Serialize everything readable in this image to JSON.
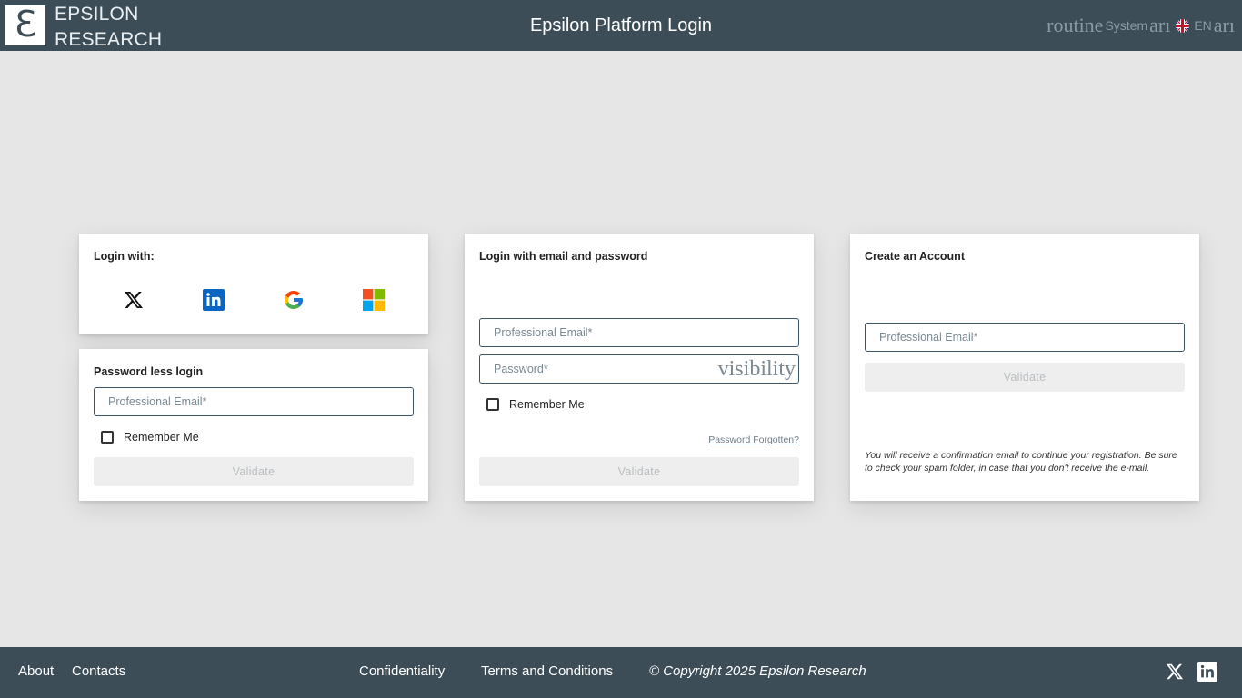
{
  "header": {
    "logo_glyph": "ℇ",
    "logo_line1": "EPSILON",
    "logo_line2": "RESEARCH",
    "title": "Epsilon Platform Login",
    "theme_icon": "routine",
    "theme_label": "System",
    "theme_dropdown_icon": "arı",
    "language": "EN",
    "language_dropdown_icon": "arı",
    "language_flag_icon": "uk-flag-icon"
  },
  "social_card": {
    "title": "Login with:",
    "providers": [
      "x-icon",
      "linkedin-icon",
      "google-icon",
      "microsoft-icon"
    ]
  },
  "passwordless_card": {
    "title": "Password less login",
    "email_placeholder": "Professional Email*",
    "remember_label": "Remember Me",
    "validate_label": "Validate"
  },
  "email_password_card": {
    "title": "Login with email and password",
    "email_placeholder": "Professional Email*",
    "password_placeholder": "Password*",
    "visibility_icon": "visibility",
    "remember_label": "Remember Me",
    "forgot_label": "Password Forgotten?",
    "validate_label": "Validate"
  },
  "create_account_card": {
    "title": "Create an Account",
    "email_placeholder": "Professional Email*",
    "validate_label": "Validate",
    "note": "You will receive a confirmation email to continue your registration. Be sure to check your spam folder, in case that you don't receive the e-mail."
  },
  "footer": {
    "about": "About",
    "contacts": "Contacts",
    "confidentiality": "Confidentiality",
    "terms": "Terms and Conditions",
    "copyright": "© Copyright 2025 Epsilon Research",
    "social_icons": [
      "x-icon",
      "linkedin-icon"
    ]
  },
  "colors": {
    "header_bg": "#3d4d57",
    "page_bg": "#e6e6e6",
    "field_border": "#3d5663",
    "disabled_button_bg": "#eeeeee"
  }
}
